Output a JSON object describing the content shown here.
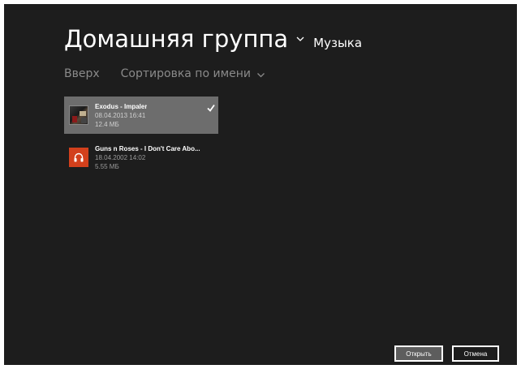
{
  "header": {
    "title": "Домашняя группа",
    "subtitle": "Музыка"
  },
  "subnav": {
    "up_label": "Вверх",
    "sort_label": "Сортировка по имени"
  },
  "files": [
    {
      "name": "Exodus - Impaler",
      "date": "08.04.2013 16:41",
      "size": "12.4 МБ",
      "selected": true,
      "thumb": "album-art"
    },
    {
      "name": "Guns n Roses - I Don't Care Abo...",
      "date": "18.04.2002 14:02",
      "size": "5.55 МБ",
      "selected": false,
      "thumb": "headphones-icon"
    }
  ],
  "buttons": {
    "open_label": "Открыть",
    "cancel_label": "Отмена"
  },
  "colors": {
    "background": "#1d1d1d",
    "selected_item": "#6d6d6d",
    "music_tile": "#d2401c",
    "open_button": "#5d5d5d"
  }
}
